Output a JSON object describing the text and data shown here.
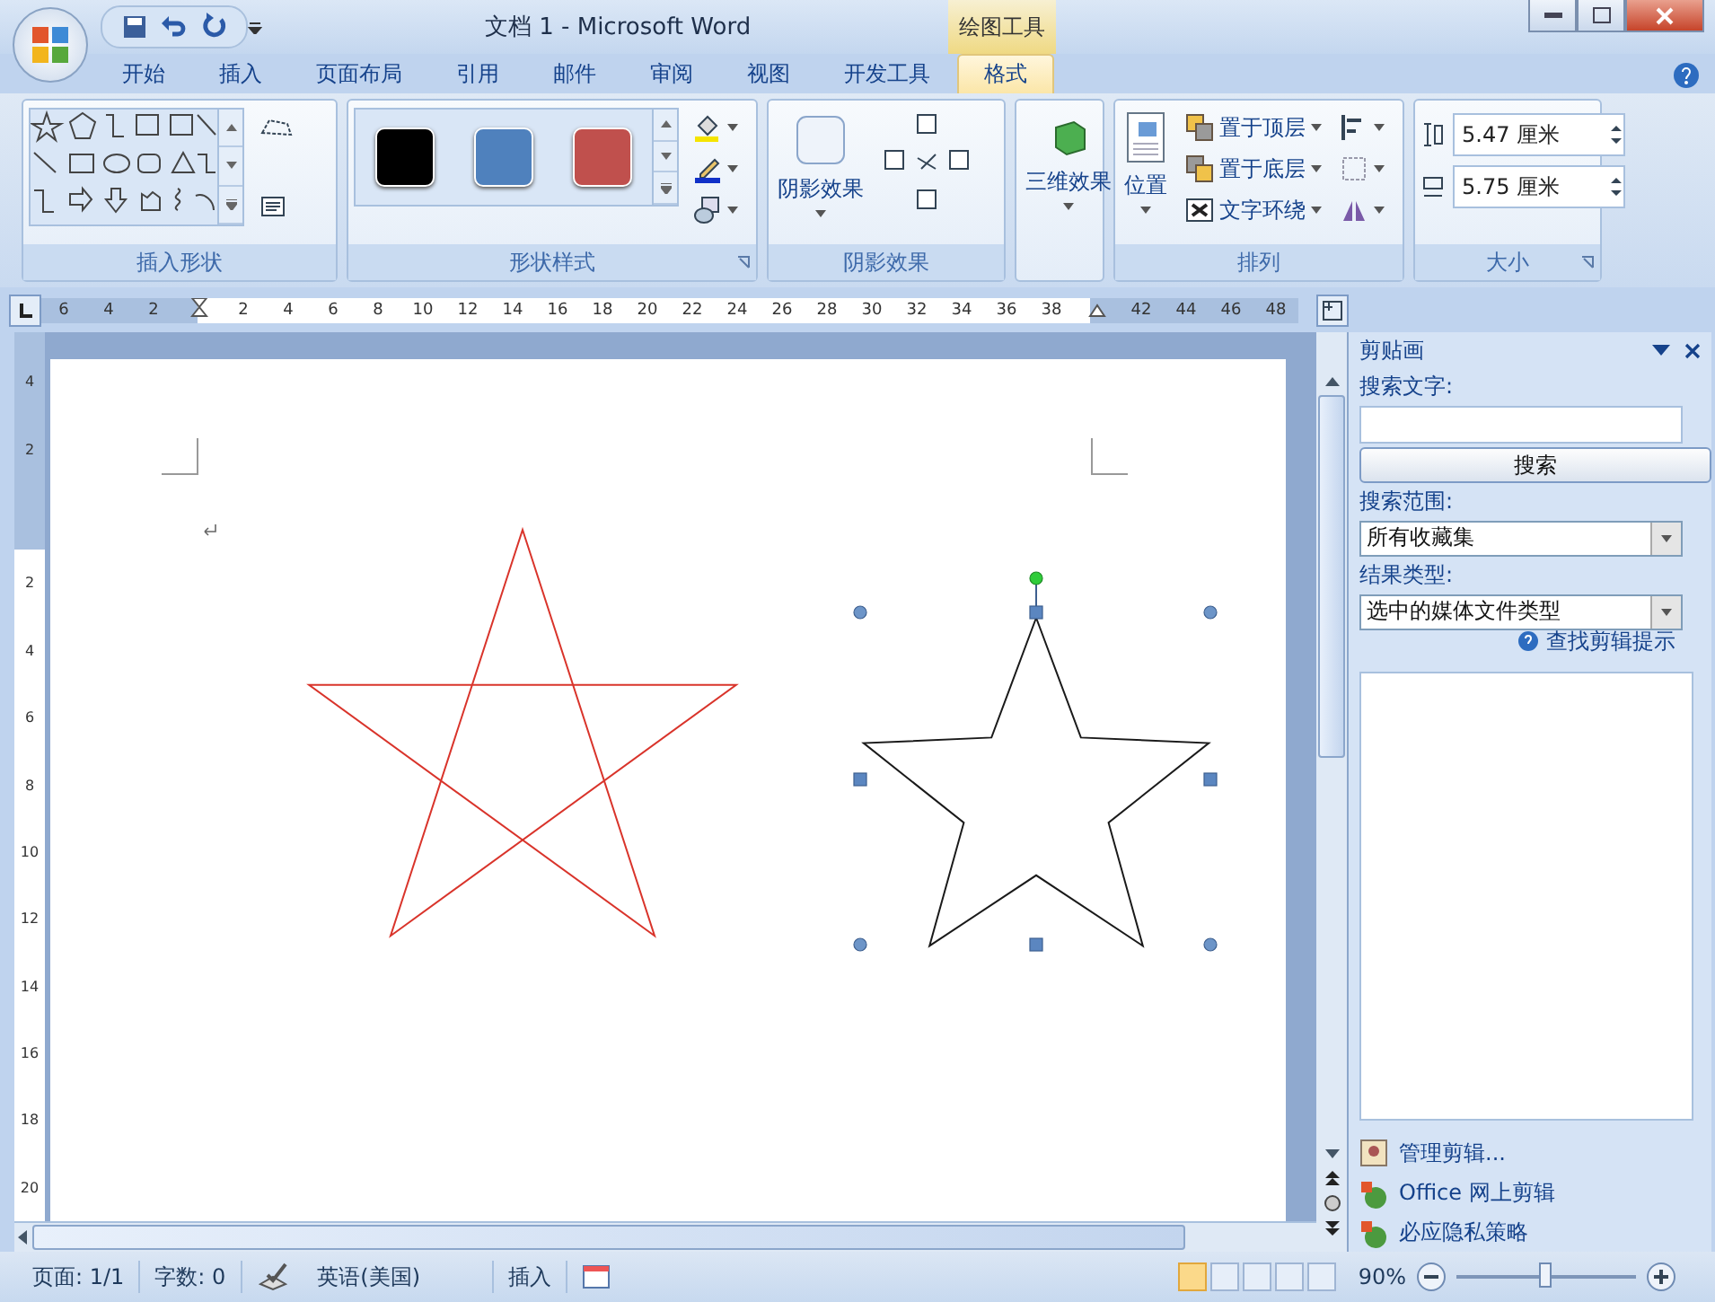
{
  "window": {
    "title": "文档 1 - Microsoft Word",
    "contextual_tab": "绘图工具"
  },
  "tabs": [
    {
      "label": "开始",
      "selected": false
    },
    {
      "label": "插入",
      "selected": false
    },
    {
      "label": "页面布局",
      "selected": false
    },
    {
      "label": "引用",
      "selected": false
    },
    {
      "label": "邮件",
      "selected": false
    },
    {
      "label": "审阅",
      "selected": false
    },
    {
      "label": "视图",
      "selected": false
    },
    {
      "label": "开发工具",
      "selected": false
    },
    {
      "label": "格式",
      "selected": true
    }
  ],
  "ribbon": {
    "insert_shapes": {
      "label": "插入形状"
    },
    "shape_styles": {
      "label": "形状样式",
      "swatches": [
        {
          "color": "#000000"
        },
        {
          "color": "#4f81bd"
        },
        {
          "color": "#c0504d"
        }
      ]
    },
    "shadow_effects": {
      "label": "阴影效果",
      "button": "阴影效果"
    },
    "effects_3d": {
      "button": "三维效果"
    },
    "arrange": {
      "label": "排列",
      "position_button": "位置",
      "commands": [
        "置于顶层",
        "置于底层",
        "文字环绕"
      ]
    },
    "size": {
      "label": "大小",
      "height": "5.47 厘米",
      "width": "5.75 厘米"
    }
  },
  "ruler": {
    "left_ticks": [
      "6",
      "4",
      "2"
    ],
    "ticks": [
      "2",
      "4",
      "6",
      "8",
      "10",
      "12",
      "14",
      "16",
      "18",
      "20",
      "22",
      "24",
      "26",
      "28",
      "30",
      "32",
      "34",
      "36",
      "38"
    ],
    "right_ticks": [
      "42",
      "44",
      "46",
      "48"
    ]
  },
  "vertical_ruler": {
    "top_ticks": [
      "4",
      "2"
    ],
    "ticks": [
      "2",
      "4",
      "6",
      "8",
      "10",
      "12",
      "14",
      "16",
      "18",
      "20"
    ]
  },
  "document": {
    "shapes": [
      {
        "kind": "star",
        "color": "#d9342b",
        "selected": false
      },
      {
        "kind": "star",
        "color": "#1a1a1a",
        "selected": true
      }
    ]
  },
  "clip_art_pane": {
    "title": "剪贴画",
    "search_label": "搜索文字:",
    "search_button": "搜索",
    "scope_label": "搜索范围:",
    "scope_value": "所有收藏集",
    "type_label": "结果类型:",
    "type_value": "选中的媒体文件类型",
    "help_link": "查找剪辑提示",
    "links": [
      "管理剪辑...",
      "Office 网上剪辑",
      "必应隐私策略"
    ]
  },
  "status_bar": {
    "page": "页面: 1/1",
    "words": "字数: 0",
    "language": "英语(美国)",
    "mode": "插入",
    "zoom": "90%",
    "zoom_slider": {
      "level": 0.5
    }
  }
}
